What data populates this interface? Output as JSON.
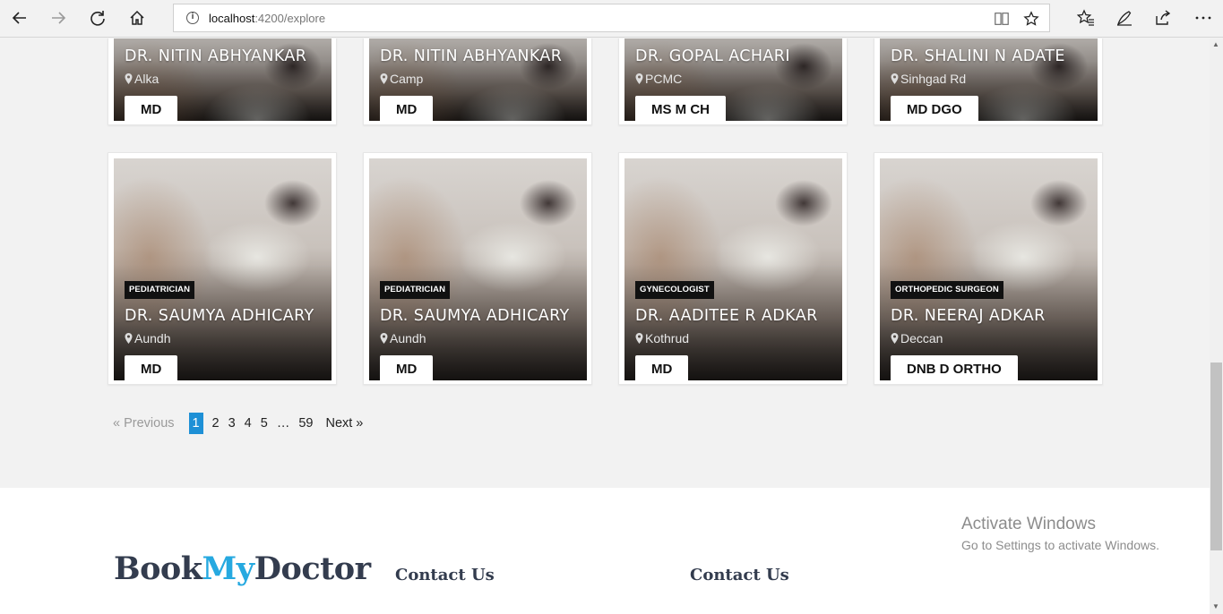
{
  "browser": {
    "url_host": "localhost",
    "url_path": ":4200/explore"
  },
  "top_row": [
    {
      "name": "DR. NITIN ABHYANKAR",
      "location": "Alka",
      "degree": "MD"
    },
    {
      "name": "DR. NITIN ABHYANKAR",
      "location": "Camp",
      "degree": "MD"
    },
    {
      "name": "DR. GOPAL ACHARI",
      "location": "PCMC",
      "degree": "MS M CH"
    },
    {
      "name": "DR. SHALINI N ADATE",
      "location": "Sinhgad Rd",
      "degree": "MD DGO"
    }
  ],
  "second_row": [
    {
      "specialty": "PEDIATRICIAN",
      "name": "DR. SAUMYA ADHICARY",
      "location": "Aundh",
      "degree": "MD"
    },
    {
      "specialty": "PEDIATRICIAN",
      "name": "DR. SAUMYA ADHICARY",
      "location": "Aundh",
      "degree": "MD"
    },
    {
      "specialty": "GYNECOLOGIST",
      "name": "DR. AADITEE R ADKAR",
      "location": "Kothrud",
      "degree": "MD"
    },
    {
      "specialty": "ORTHOPEDIC SURGEON",
      "name": "DR. NEERAJ ADKAR",
      "location": "Deccan",
      "degree": "DNB D ORTHO"
    }
  ],
  "pagination": {
    "previous": "« Previous",
    "pages": [
      "1",
      "2",
      "3",
      "4",
      "5",
      "…",
      "59"
    ],
    "active": "1",
    "next": "Next »"
  },
  "footer": {
    "logo_part1": "Book",
    "logo_part2": "My",
    "logo_part3": "Doctor",
    "col1_title": "Contact Us",
    "col2_title": "Contact Us"
  },
  "watermark": {
    "line1": "Activate Windows",
    "line2": "Go to Settings to activate Windows."
  },
  "colors": {
    "accent": "#26a9e0",
    "page_active": "#1e90d6",
    "logo_dark": "#333c4e"
  }
}
